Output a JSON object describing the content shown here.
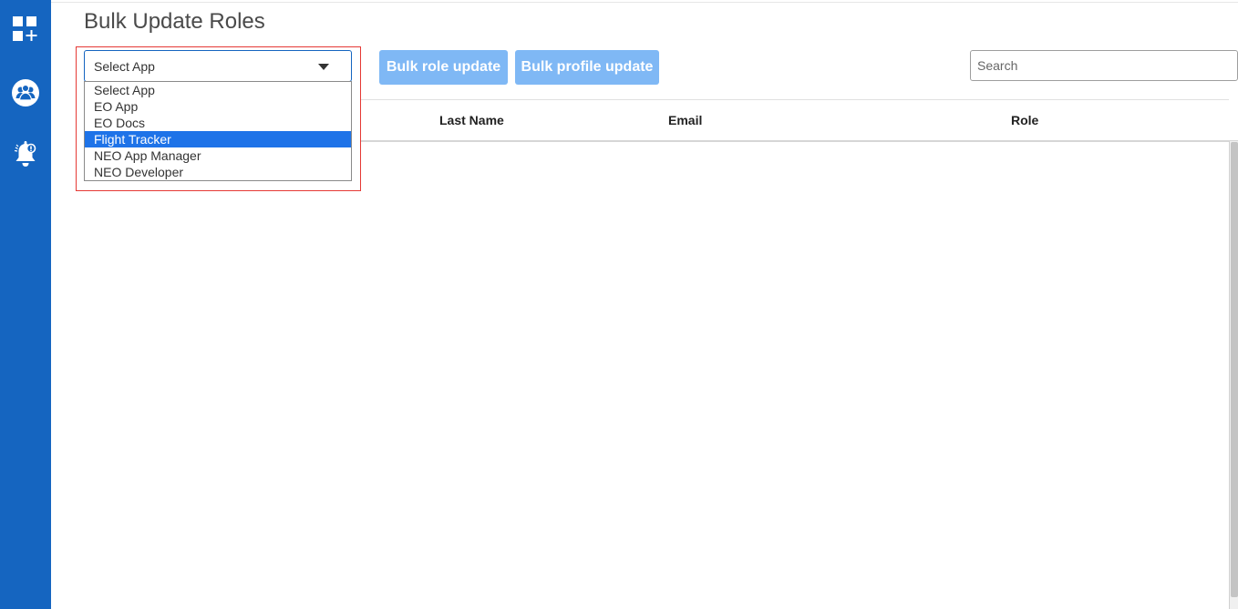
{
  "page": {
    "title": "Bulk Update Roles"
  },
  "sidebar": {
    "items": [
      {
        "icon": "grid-add-icon"
      },
      {
        "icon": "users-group-icon"
      },
      {
        "icon": "notification-bell-icon"
      }
    ]
  },
  "app_select": {
    "value": "Select App",
    "options": [
      "Select App",
      "EO App",
      "EO Docs",
      "Flight Tracker",
      "NEO App Manager",
      "NEO Developer"
    ],
    "highlighted": "Flight Tracker"
  },
  "toolbar": {
    "bulk_role_label": "Bulk role update",
    "bulk_profile_label": "Bulk profile update"
  },
  "search": {
    "placeholder": "Search",
    "value": ""
  },
  "table": {
    "columns": [
      "Last Name",
      "Email",
      "Role"
    ],
    "rows": []
  },
  "colors": {
    "sidebar": "#1565c0",
    "button": "#7fb8f5",
    "option_highlight": "#1e73e8",
    "annotation_border": "#e53935"
  }
}
